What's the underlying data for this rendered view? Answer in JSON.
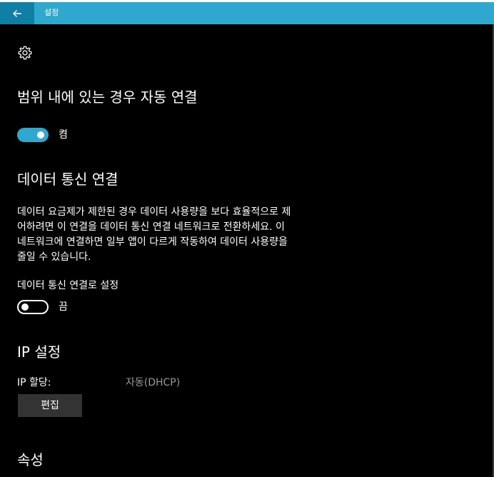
{
  "titlebar": {
    "title": "설정",
    "back_icon": "arrow-left-icon",
    "color": "#2ea8cf",
    "back_bg": "#0f7fa6"
  },
  "page_icon": "gear-icon",
  "auto_connect": {
    "heading": "범위 내에 있는 경우 자동 연결",
    "toggle_state": "on",
    "toggle_label": "켬",
    "accent": "#2ea8cf"
  },
  "metered": {
    "heading": "데이터 통신 연결",
    "description_lines": [
      "데이터 요금제가 제한된 경우 데이터 사용량을 보다 효율적으로 제",
      "어하려면 이 연결을 데이터 통신 연결 네트워크로 전환하세요. 이",
      "네트워크에 연결하면 일부 앱이 다르게 작동하여 데이터 사용량을",
      "줄일 수 있습니다."
    ],
    "setting_label": "데이터 통신 연결로 설정",
    "toggle_state": "off",
    "toggle_label": "끔"
  },
  "ip": {
    "heading": "IP 설정",
    "assignment_label": "IP 할당:",
    "assignment_value": "자동(DHCP)",
    "edit_button": "편집"
  },
  "properties": {
    "heading": "속성"
  }
}
